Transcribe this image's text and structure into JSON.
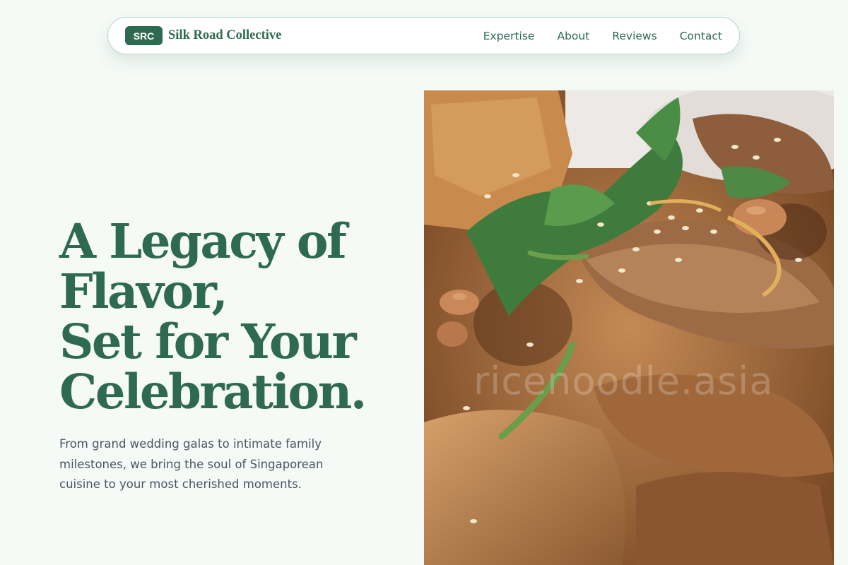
{
  "nav": {
    "badge": "SRC",
    "brand_name": "Silk Road Collective",
    "links": [
      "Expertise",
      "About",
      "Reviews",
      "Contact"
    ]
  },
  "hero": {
    "title_lines": [
      "A Legacy of",
      "Flavor,",
      "Set for Your",
      "Celebration."
    ],
    "subtitle": "From grand wedding galas to intimate family milestones, we bring the soul of Singaporean cuisine to your most cherished moments."
  },
  "photo": {
    "watermark": "ricenoodle.asia"
  },
  "colors": {
    "brand": "#2e6a51",
    "background": "#f5faf7",
    "text_muted": "#4a5560"
  }
}
